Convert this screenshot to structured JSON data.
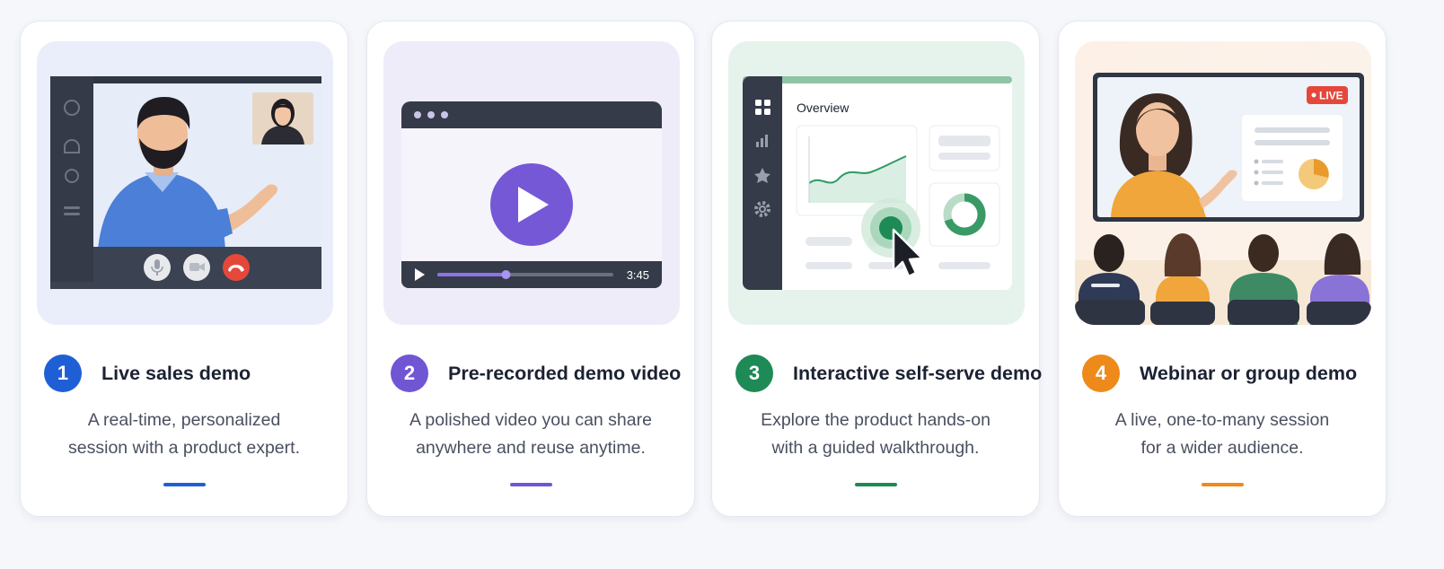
{
  "cards": [
    {
      "number": "1",
      "title": "Live sales demo",
      "description_line1": "A real-time, personalized",
      "description_line2": "session with a product expert.",
      "accent_color": "#1f5fd6",
      "illustration": "video-call-illustration"
    },
    {
      "number": "2",
      "title": "Pre-recorded demo video",
      "description_line1": "A polished video you can share",
      "description_line2": "anywhere and reuse anytime.",
      "accent_color": "#7156d3",
      "illustration": "video-player-illustration",
      "player": {
        "duration": "3:45",
        "progress": 0.39
      }
    },
    {
      "number": "3",
      "title": "Interactive self-serve demo",
      "description_line1": "Explore the product hands-on",
      "description_line2": "with a guided walkthrough.",
      "accent_color": "#1e8a55",
      "illustration": "dashboard-walkthrough-illustration",
      "dashboard": {
        "heading": "Overview"
      }
    },
    {
      "number": "4",
      "title": "Webinar or group demo",
      "description_line1": "A live, one-to-many session",
      "description_line2": "for a wider audience.",
      "accent_color": "#ee8a1a",
      "illustration": "webinar-audience-illustration",
      "badge": "LIVE"
    }
  ]
}
